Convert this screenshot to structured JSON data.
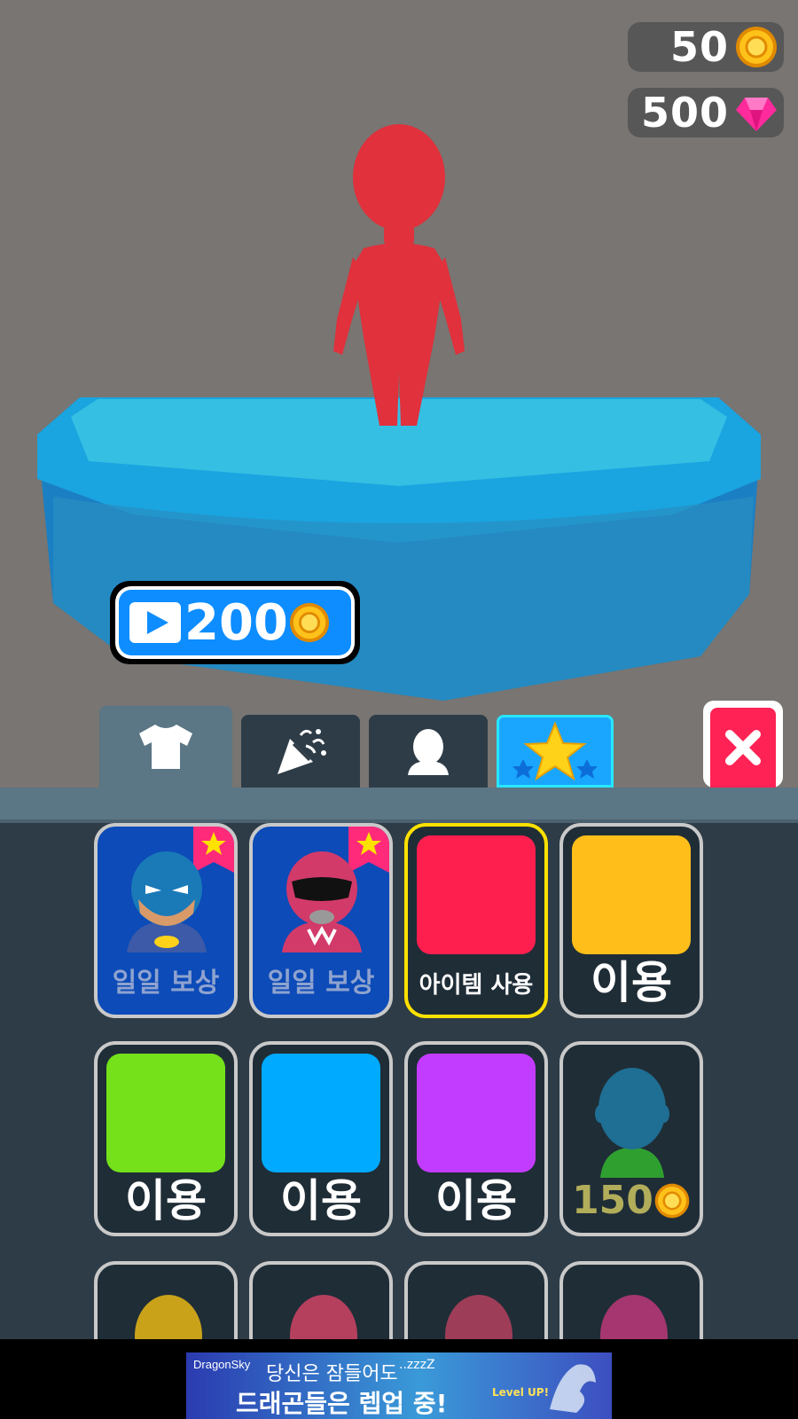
{
  "currency": {
    "coins": "50",
    "gems": "500"
  },
  "ad_reward": {
    "amount": "200",
    "icon_play": "play-icon",
    "icon_coin": "coin-icon"
  },
  "tabs": [
    {
      "name": "outfit",
      "icon": "tshirt-icon",
      "active": true
    },
    {
      "name": "celebration",
      "icon": "party-popper-icon",
      "active": false
    },
    {
      "name": "character",
      "icon": "head-icon",
      "active": false
    },
    {
      "name": "special",
      "icon": "star-icon",
      "active": false
    }
  ],
  "close": {
    "icon": "close-icon",
    "color": "#ff2255"
  },
  "items": [
    {
      "type": "hero",
      "label": "일일 보상",
      "avatar": "batman-avatar"
    },
    {
      "type": "hero",
      "label": "일일 보상",
      "avatar": "ranger-avatar"
    },
    {
      "type": "color",
      "color": "#ff1f4f",
      "label": "아이템 사용",
      "selected": true
    },
    {
      "type": "color",
      "color": "#ffbe1a",
      "label": "이용"
    },
    {
      "type": "color",
      "color": "#74e11b",
      "label": "이용"
    },
    {
      "type": "color",
      "color": "#00aaff",
      "label": "이용"
    },
    {
      "type": "color",
      "color": "#c23cff",
      "label": "이용"
    },
    {
      "type": "avatar",
      "color": "#1f6e93",
      "price": "150"
    }
  ],
  "ad_banner": {
    "brand": "DragonSky",
    "line1": "당신은 잠들어도",
    "zzz": "..zzzZ",
    "line2": "드래곤들은 렙업 중!",
    "badge": "Level UP!"
  }
}
